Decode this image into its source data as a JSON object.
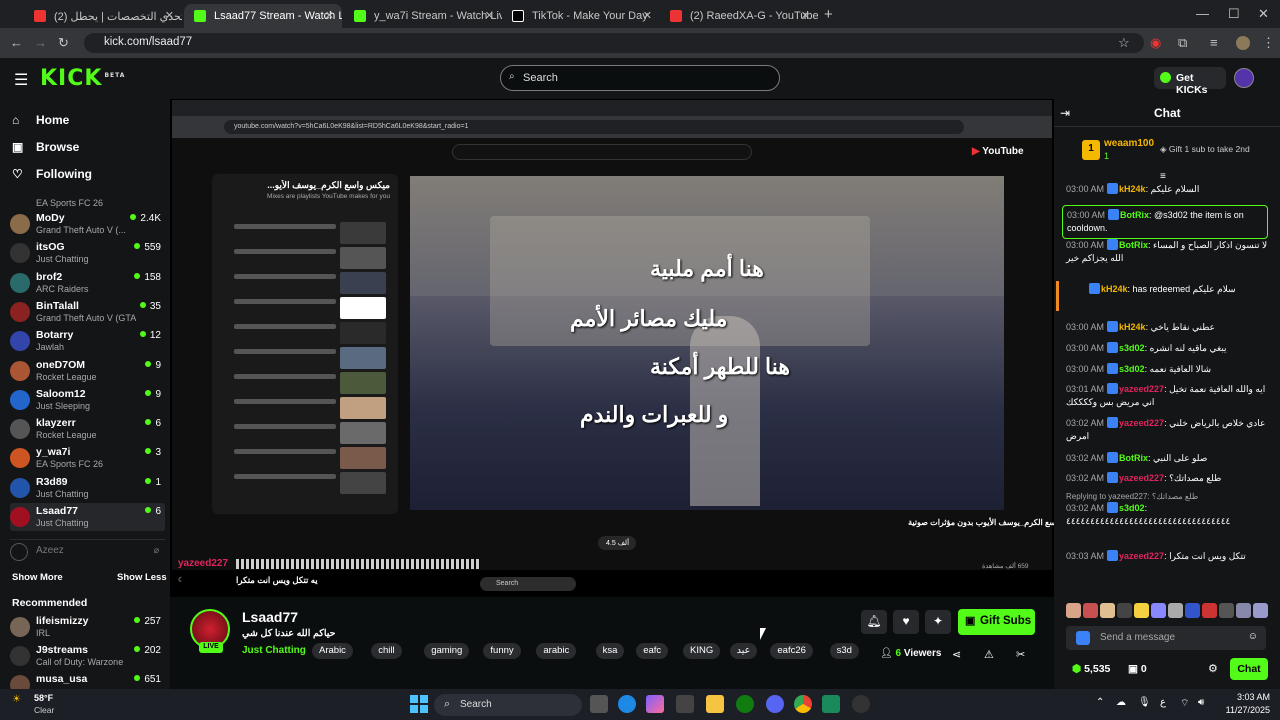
{
  "browser": {
    "tabs": [
      {
        "label": "(2) تحدي التخصصات | يحطل",
        "color": "#e33"
      },
      {
        "label": "Lsaad77 Stream - Watch Liv",
        "color": "#53fc18",
        "active": true
      },
      {
        "label": "y_wa7i Stream - Watch Live on",
        "color": "#53fc18"
      },
      {
        "label": "TikTok - Make Your Day",
        "color": "#fff"
      },
      {
        "label": "(2) RaeedXA-G - YouTube",
        "color": "#e33"
      }
    ],
    "url": "kick.com/lsaad77"
  },
  "kick": {
    "logo": "KICK",
    "logo_sup": "BETA",
    "search_placeholder": "Search",
    "get_kicks": "Get KICKs"
  },
  "sidebar": {
    "nav": [
      {
        "label": "Home",
        "icon": "home-icon"
      },
      {
        "label": "Browse",
        "icon": "browse-icon"
      },
      {
        "label": "Following",
        "icon": "heart-icon"
      }
    ],
    "following_top_game": "EA Sports FC 26",
    "channels": [
      {
        "name": "MoDy",
        "game": "Grand Theft Auto V (...",
        "viewers": "2.4K",
        "color": "#8a6b4a"
      },
      {
        "name": "itsOG",
        "game": "Just Chatting",
        "viewers": "559",
        "color": "#333"
      },
      {
        "name": "brof2",
        "game": "ARC Raiders",
        "viewers": "158",
        "color": "#2a6a6a"
      },
      {
        "name": "BinTalall",
        "game": "Grand Theft Auto V (GTA)",
        "viewers": "35",
        "color": "#8b2222"
      },
      {
        "name": "Botarry",
        "game": "Jawlah",
        "viewers": "12",
        "color": "#3344aa"
      },
      {
        "name": "oneD7OM",
        "game": "Rocket League",
        "viewers": "9",
        "color": "#aa5533"
      },
      {
        "name": "Saloom12",
        "game": "Just Sleeping",
        "viewers": "9",
        "color": "#2266cc"
      },
      {
        "name": "klayzerr",
        "game": "Rocket League",
        "viewers": "6",
        "color": "#555"
      },
      {
        "name": "y_wa7i",
        "game": "EA Sports FC 26",
        "viewers": "3",
        "color": "#cc5522"
      },
      {
        "name": "R3d89",
        "game": "Just Chatting",
        "viewers": "1",
        "color": "#2255aa"
      },
      {
        "name": "Lsaad77",
        "game": "Just Chatting",
        "viewers": "6",
        "color": "#a01020"
      }
    ],
    "offline_channel": "Azeez",
    "show_more": "Show More",
    "show_less": "Show Less",
    "recommended_title": "Recommended",
    "recommended": [
      {
        "name": "lifeismizzy",
        "game": "IRL",
        "viewers": "257",
        "color": "#776655"
      },
      {
        "name": "J9streams",
        "game": "Call of Duty: Warzone",
        "viewers": "202",
        "color": "#333"
      },
      {
        "name": "musa_usa",
        "game": "",
        "viewers": "651",
        "color": "#6a4a3a"
      }
    ]
  },
  "stream": {
    "yt_playlist_title": "ميكس واسع الكرم_يوسف الأيو...",
    "yt_playlist_sub": "Mixes are playlists YouTube makes for you",
    "yt_url": "youtube.com/watch?v=5hCa6L0eK98&list=RD5hCa6L0eK98&start_radio=1",
    "lyrics": [
      "هنا أمم ملبية",
      "مليك مصائر الأمم",
      "هنا للطهر أمكنة",
      "و للعبرات والندم"
    ],
    "yt_video_title": "واسع الكرم_يوسف الأيوب بدون مؤثرات صوتية",
    "yt_likes": "4.5 ألف",
    "yt_views": "659 ألف مشاهدة",
    "overlay_user": "yazeed227",
    "overlay_msg": "يه تتكل ويس انت متكرا"
  },
  "channel": {
    "name": "Lsaad77",
    "title": "حياكم الله عندنا كل شي",
    "category": "Just Chatting",
    "live_label": "LIVE",
    "tags": [
      "Arabic",
      "chill",
      "gaming",
      "funny",
      "arabic",
      "ksa",
      "eafc",
      "KING",
      "عيد",
      "eafc26",
      "s3d"
    ],
    "viewers_count": "6",
    "viewers_label": "Viewers",
    "gift_subs": "Gift Subs"
  },
  "chat": {
    "title": "Chat",
    "pinned_user": "weaam100",
    "pinned_count": "1",
    "pinned_gift_text": "Gift 1 sub to take 2nd",
    "messages": [
      {
        "time": "03:00 AM",
        "user": "kH24k",
        "color": "#f5b800",
        "text": "السلام عليكم"
      },
      {
        "time": "03:00 AM",
        "user": "BotRix",
        "color": "#53fc18",
        "text": "@s3d02 the item is on cooldown."
      },
      {
        "time": "03:00 AM",
        "user": "BotRix",
        "color": "#53fc18",
        "text": "لا تنسون اذكار الصباح و المساء الله يجزاكم خير"
      },
      {
        "time": "",
        "user": "kH24k",
        "color": "#f5b800",
        "text": "has redeemed سلام عليكم"
      },
      {
        "time": "03:00 AM",
        "user": "kH24k",
        "color": "#f5b800",
        "text": "عطني نقاط ياخي"
      },
      {
        "time": "03:00 AM",
        "user": "s3d02",
        "color": "#53fc18",
        "text": "يبغي ماقيه لنه انشره"
      },
      {
        "time": "03:00 AM",
        "user": "s3d02",
        "color": "#53fc18",
        "text": "شالا العافية نعمه"
      },
      {
        "time": "03:01 AM",
        "user": "yazeed227",
        "color": "#e0245e",
        "text": "ايه والله العافية نعمة تخيل اني مريض بس وككككك"
      },
      {
        "time": "03:02 AM",
        "user": "yazeed227",
        "color": "#e0245e",
        "text": "عادي خلاص بالرياض خلني امرض"
      },
      {
        "time": "03:02 AM",
        "user": "BotRix",
        "color": "#53fc18",
        "text": "صلو على النبي"
      },
      {
        "time": "03:02 AM",
        "user": "yazeed227",
        "color": "#e0245e",
        "text": "طلع مصداتك؟"
      },
      {
        "time": "03:02 AM",
        "user": "s3d02",
        "color": "#53fc18",
        "text": "٤٤٤٤٤٤٤٤٤٤٤٤٤٤٤٤٤٤٤٤٤٤٤٤٤٤٤٤٤٤٤٤٤٤"
      },
      {
        "time": "03:03 AM",
        "user": "yazeed227",
        "color": "#e0245e",
        "text": "تتكل ويس انت متكرا"
      }
    ],
    "reply_to": "Replying to yazeed227: طلع مصداتك؟",
    "input_placeholder": "Send a message",
    "points": "5,535",
    "sub_count": "0",
    "chat_button": "Chat"
  },
  "taskbar": {
    "weather_temp": "58°F",
    "weather_text": "Clear",
    "search_label": "Search",
    "time": "3:03 AM",
    "date": "11/27/2025"
  }
}
